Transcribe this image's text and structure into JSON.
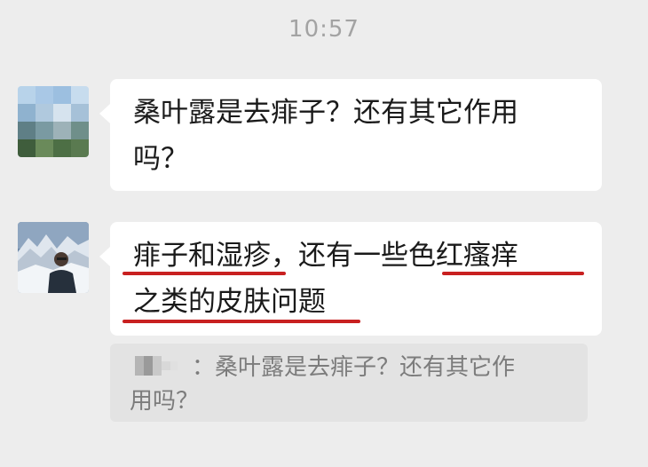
{
  "status": {
    "time": "10:57"
  },
  "messages": [
    {
      "sender": "other",
      "text_line1": "桑叶露是去痱子？还有其它作用",
      "text_line2": "吗？"
    },
    {
      "sender": "reply",
      "text_line1": "痱子和湿疹，还有一些色红瘙痒",
      "text_line2": "之类的皮肤问题"
    }
  ],
  "quote": {
    "separator": "：",
    "text": "桑叶露是去痱子？还有其它作",
    "text_line2": "用吗？"
  },
  "colors": {
    "background": "#ededed",
    "bubble": "#ffffff",
    "underline": "#c82020",
    "quote_bg": "#e3e3e3"
  },
  "icons": {
    "avatar_1": "blurred-avatar-icon",
    "avatar_2": "mountain-portrait-avatar-icon"
  }
}
